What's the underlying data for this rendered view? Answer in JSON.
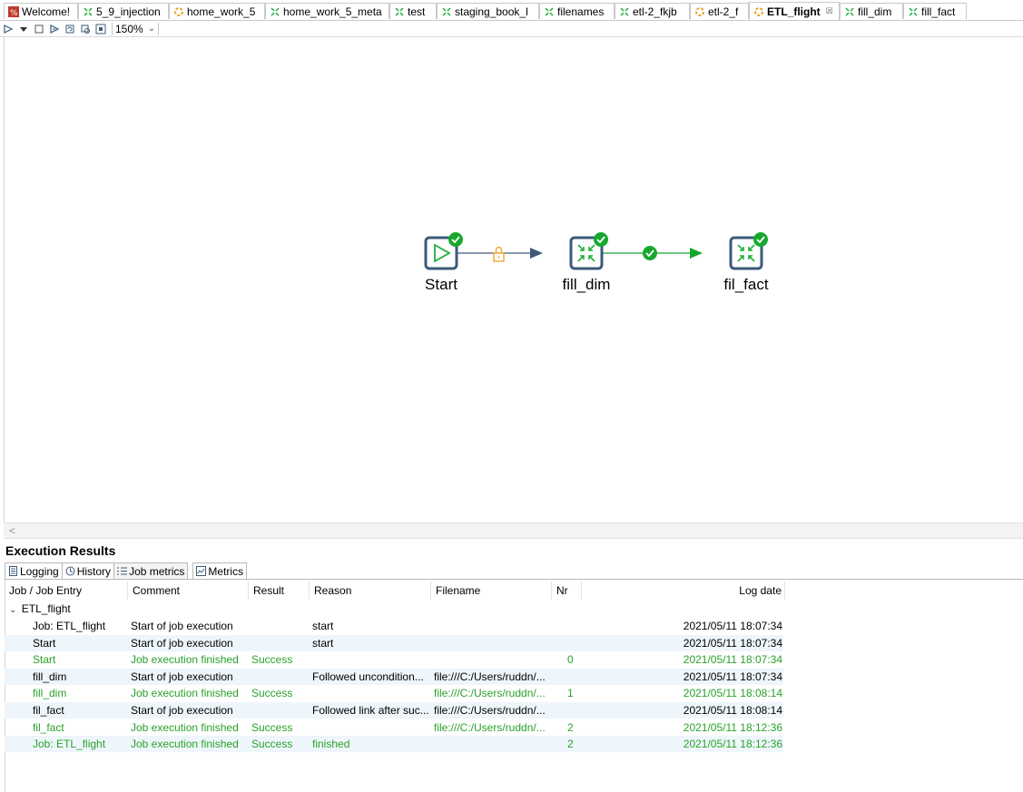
{
  "tabs": [
    {
      "label": "Welcome!",
      "icon": "welcome-icon"
    },
    {
      "label": "5_9_injection",
      "icon": "transformation-icon"
    },
    {
      "label": "home_work_5",
      "icon": "job-icon"
    },
    {
      "label": "home_work_5_meta",
      "icon": "transformation-icon"
    },
    {
      "label": "test",
      "icon": "transformation-icon"
    },
    {
      "label": "staging_book_l",
      "icon": "transformation-icon"
    },
    {
      "label": "filenames",
      "icon": "transformation-icon"
    },
    {
      "label": "etl-2_fkjb",
      "icon": "transformation-icon"
    },
    {
      "label": "etl-2_f",
      "icon": "job-icon"
    },
    {
      "label": "ETL_flight",
      "icon": "job-icon",
      "active": true
    },
    {
      "label": "fill_dim",
      "icon": "transformation-icon"
    },
    {
      "label": "fill_fact",
      "icon": "transformation-icon"
    }
  ],
  "toolbar": {
    "zoom": "150%"
  },
  "canvas": {
    "nodes": [
      {
        "label": "Start",
        "icon": "start-icon",
        "status": "success"
      },
      {
        "label": "fill_dim",
        "icon": "transformation-entry-icon",
        "status": "success"
      },
      {
        "label": "fil_fact",
        "icon": "transformation-entry-icon",
        "status": "success"
      }
    ],
    "hops": [
      {
        "from": "Start",
        "to": "fill_dim",
        "type": "unconditional",
        "icon": "lock-icon",
        "color": "#3c5a78"
      },
      {
        "from": "fill_dim",
        "to": "fil_fact",
        "type": "on-success",
        "icon": "check-icon",
        "color": "#16a82e"
      }
    ]
  },
  "results": {
    "title": "Execution Results",
    "tabs": [
      "Logging",
      "History",
      "Job metrics",
      "Metrics"
    ],
    "active_tab": "Job metrics",
    "columns": [
      "Job / Job Entry",
      "Comment",
      "Result",
      "Reason",
      "Filename",
      "Nr",
      "Log date"
    ],
    "root": "ETL_flight",
    "rows": [
      {
        "entry": "Job: ETL_flight",
        "comment": "Start of job execution",
        "result": "",
        "reason": "start",
        "filename": "",
        "nr": "",
        "date": "2021/05/11 18:07:34",
        "finished": false
      },
      {
        "entry": "Start",
        "comment": "Start of job execution",
        "result": "",
        "reason": "start",
        "filename": "",
        "nr": "",
        "date": "2021/05/11 18:07:34",
        "finished": false
      },
      {
        "entry": "Start",
        "comment": "Job execution finished",
        "result": "Success",
        "reason": "",
        "filename": "",
        "nr": "0",
        "date": "2021/05/11 18:07:34",
        "finished": true
      },
      {
        "entry": "fill_dim",
        "comment": "Start of job execution",
        "result": "",
        "reason": "Followed uncondition...",
        "filename": "file:///C:/Users/ruddn/...",
        "nr": "",
        "date": "2021/05/11 18:07:34",
        "finished": false
      },
      {
        "entry": "fill_dim",
        "comment": "Job execution finished",
        "result": "Success",
        "reason": "",
        "filename": "file:///C:/Users/ruddn/...",
        "nr": "1",
        "date": "2021/05/11 18:08:14",
        "finished": true
      },
      {
        "entry": "fil_fact",
        "comment": "Start of job execution",
        "result": "",
        "reason": "Followed link after suc...",
        "filename": "file:///C:/Users/ruddn/...",
        "nr": "",
        "date": "2021/05/11 18:08:14",
        "finished": false
      },
      {
        "entry": "fil_fact",
        "comment": "Job execution finished",
        "result": "Success",
        "reason": "",
        "filename": "file:///C:/Users/ruddn/...",
        "nr": "2",
        "date": "2021/05/11 18:12:36",
        "finished": true
      },
      {
        "entry": "Job: ETL_flight",
        "comment": "Job execution finished",
        "result": "Success",
        "reason": "finished",
        "filename": "",
        "nr": "2",
        "date": "2021/05/11 18:12:36",
        "finished": true
      }
    ]
  },
  "colors": {
    "success_green": "#2aa12a",
    "node_border": "#3c5a78",
    "start_green": "#1fae3a",
    "lock_orange": "#f0a020",
    "row_alt": "#eef6fb"
  }
}
